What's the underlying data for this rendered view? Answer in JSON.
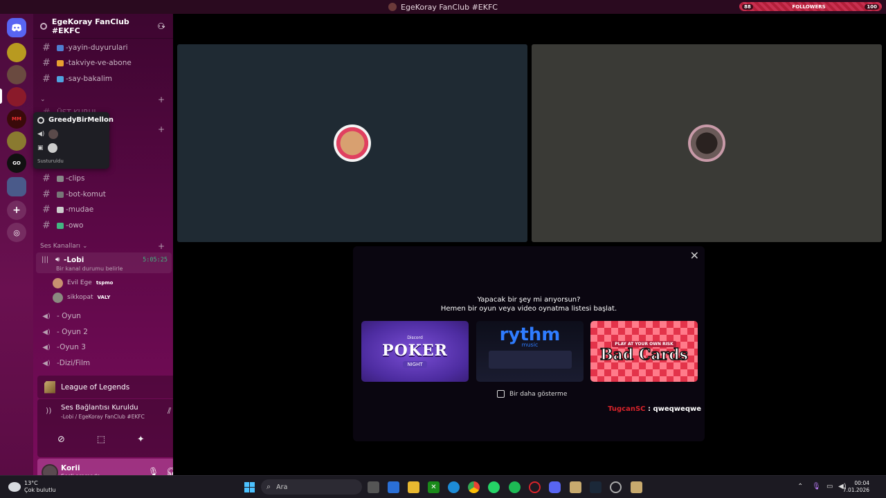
{
  "window": {
    "title": "EgeKoray FanClub #EKFC"
  },
  "overlay": {
    "followers_left": "88",
    "followers_label": "FOLLOWERS",
    "followers_right": "100"
  },
  "server": {
    "name": "EgeKoray FanClub #EKFC",
    "chevron": "⌄"
  },
  "channels": [
    {
      "name": "-yayin-duyurulari",
      "emoji_color": "#4f7fd1"
    },
    {
      "name": "-takviye-ve-abone",
      "emoji_color": "#e8a030"
    },
    {
      "name": "-say-bakalim",
      "emoji_color": "#4fa3e0"
    }
  ],
  "partial_category": "ÜST KURUL",
  "lower_channels": [
    {
      "name": "-clips",
      "emoji_color": "#888"
    },
    {
      "name": "-bot-komut",
      "emoji_color": "#777"
    },
    {
      "name": "-mudae",
      "emoji_color": "#ccc"
    },
    {
      "name": "-owo",
      "emoji_color": "#43b581"
    }
  ],
  "voice_category": "Ses Kanalları",
  "active_voice": {
    "name": "-Lobi",
    "status": "Bir kanal durumu belirle",
    "timer": "5:05:25"
  },
  "voice_members": [
    {
      "name": "Evil Ege",
      "tag": "tspmo",
      "color": "#c89070"
    },
    {
      "name": "sikkopat",
      "tag": "VALY",
      "color": "#8a8a80"
    }
  ],
  "voice_channels": [
    {
      "name": "- Oyun"
    },
    {
      "name": "- Oyun 2"
    },
    {
      "name": "-Oyun 3"
    },
    {
      "name": "-Dizi/Film"
    }
  ],
  "tooltip": {
    "name": "GreedyBirMellon",
    "muted": "Susturuldu"
  },
  "activity": {
    "game": "League of Legends"
  },
  "voice_panel": {
    "status": "Ses Bağlantısı Kuruldu",
    "location": "-Lobi / EgeKoray FanClub #EKFC"
  },
  "user": {
    "name": "Korii",
    "status": "Sesli aramada"
  },
  "modal": {
    "question": "Yapacak bir şey mi arıyorsun?",
    "subtitle": "Hemen bir oyun veya video oynatma listesi başlat.",
    "poker": {
      "brand": "Discord",
      "title": "POKER",
      "subtitle": "NIGHT"
    },
    "rythm": {
      "title": "rythm",
      "subtitle": "music"
    },
    "badcards": {
      "top": "PLAY AT YOUR OWN RISK",
      "title": "Bad Cards"
    },
    "checkbox_label": "Bir daha gösterme",
    "chat_user": "TugcanSC",
    "chat_message": " : qweqweqwe"
  },
  "taskbar": {
    "temperature": "13°C",
    "weather": "Çok bulutlu",
    "search_placeholder": "Ara",
    "time": "00:04",
    "date": "7.01.2026"
  },
  "colors": {
    "accent": "#5865f2",
    "sidebar": "#5a0845",
    "timer": "#43b581",
    "chat_name": "#d8232a"
  }
}
